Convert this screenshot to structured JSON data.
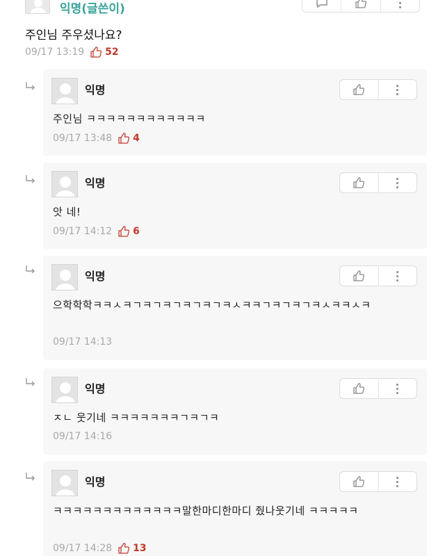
{
  "top_comment": {
    "author": "익명(글쓴이)",
    "text": "주인님 주우셨나요?",
    "time": "09/17 13:19",
    "likes": "52",
    "icons": [
      "comment-icon",
      "thumbs-up-icon",
      "more-icon"
    ]
  },
  "replies": [
    {
      "author": "익명",
      "text": "주인님 ㅋㅋㅋㅋㅋㅋㅋㅋㅋㅋㅋㅋ",
      "time": "09/17 13:48",
      "likes": "4"
    },
    {
      "author": "익명",
      "text": "앗 네!",
      "time": "09/17 14:12",
      "likes": "6"
    },
    {
      "author": "익명",
      "text": "으학학학ㅋㅋㅅㅋㄱㅋㄱㅋㄱㅋㄱㅋㄱㅋㅅㅋㅋㄱㅋㄱㅋㄱㅋㅅㅋㅋㅅㅋ",
      "time": "09/17 14:13",
      "likes": ""
    },
    {
      "author": "익명",
      "text": "ㅈㄴ 웃기네 ㅋㅋㅋㅋㅋㅋㅋㄱㅋㄱㅋ",
      "time": "09/17 14:16",
      "likes": ""
    },
    {
      "author": "익명",
      "text": "ㅋㅋㅋㅋㅋㅋㅋㅋㅋㅋㅋㅋㅋ말한마디한마디 줬나웃기네 ㅋㅋㅋㅋㅋ",
      "time": "09/17 14:28",
      "likes": "13"
    }
  ],
  "colors": {
    "author_op": "#3aa39b",
    "like_count": "#c0392b",
    "meta": "#a8a8a8",
    "card_bg": "#f7f7f7"
  }
}
